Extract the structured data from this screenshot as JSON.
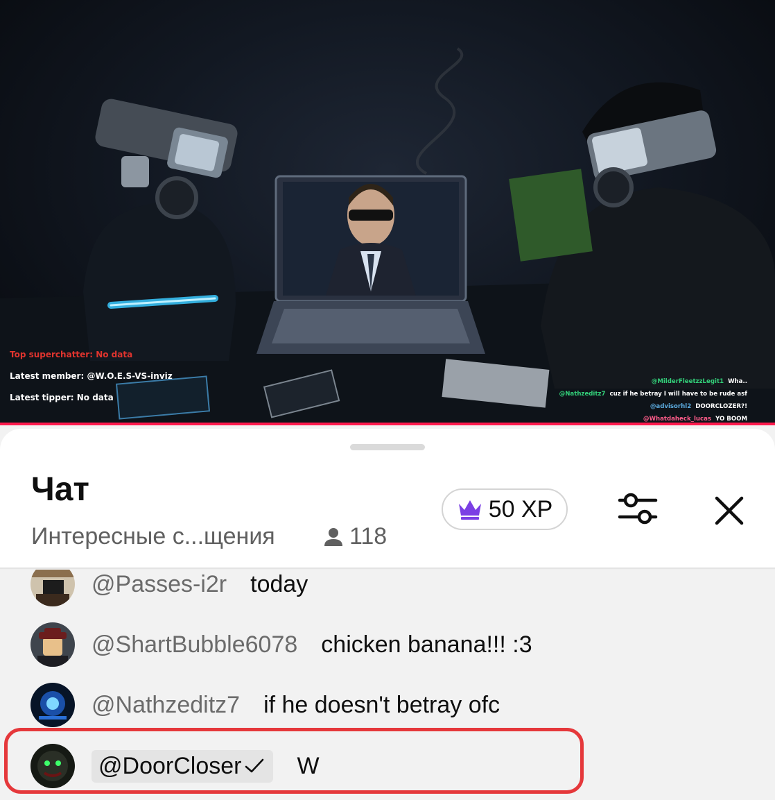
{
  "video": {
    "overlay_top_superchatter": "Top superchatter: No data",
    "overlay_latest_member": "Latest member: @W.O.E.S-VS-inviz",
    "overlay_latest_tipper": "Latest tipper: No data",
    "overlay_chat": [
      {
        "user": "@MilderFleetzzLegit1",
        "message": "Wha..",
        "color": "#33d17a"
      },
      {
        "user": "@Nathzeditz7",
        "message": "cuz if he betray I will have to be rude asf",
        "color": "#33d17a"
      },
      {
        "user": "@advisorhl2",
        "message": "DOORCLOZER?!",
        "color": "#5dade2"
      },
      {
        "user": "@Whatdaheck_lucas",
        "message": "YO BOOM",
        "color": "#ff5c8a"
      }
    ],
    "progress_color": "#ff1a4d"
  },
  "chat": {
    "title": "Чат",
    "subtitle": "Интересные с...щения",
    "viewer_count": "118",
    "xp_label": "50 XP",
    "icons": {
      "xp": "crown-icon",
      "viewers": "person-icon",
      "filter": "sliders-icon",
      "close": "close-icon",
      "verified": "checkmark-icon"
    },
    "accent_color": "#7b3fe4",
    "messages": [
      {
        "author": "@Passes-i2r",
        "text": "today"
      },
      {
        "author": "@ShartBubble6078",
        "text": "chicken banana!!! :3"
      },
      {
        "author": "@Nathzeditz7",
        "text": "if he doesn't betray ofc"
      },
      {
        "author": "@DoorCloser",
        "text": "W",
        "highlighted": true,
        "verified": true
      }
    ],
    "highlight_color": "#e5383b"
  }
}
